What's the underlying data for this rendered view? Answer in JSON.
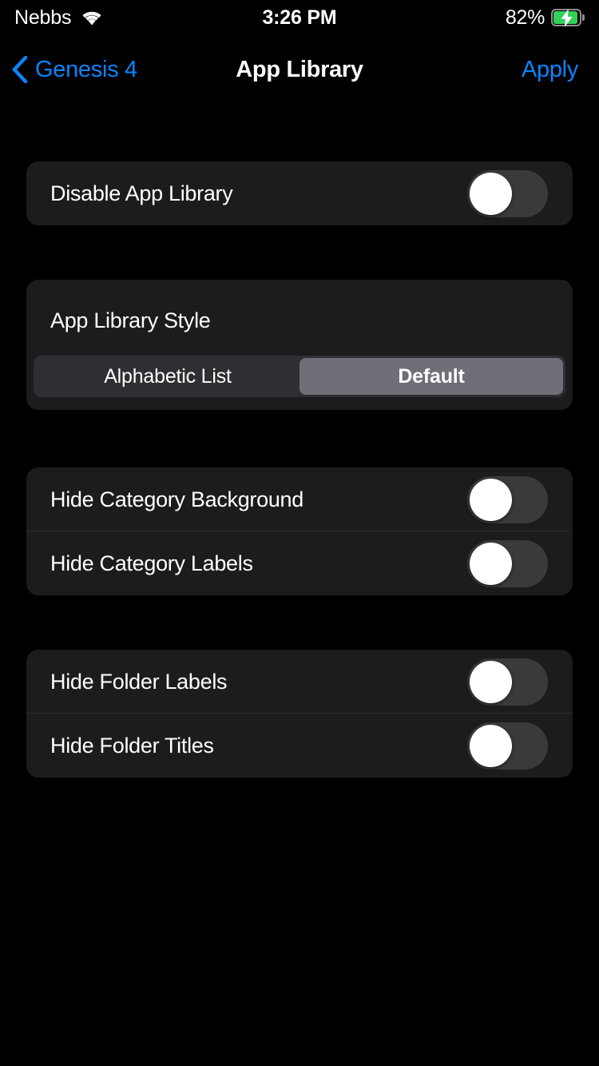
{
  "status_bar": {
    "carrier": "Nebbs",
    "wifi_icon": "wifi-icon",
    "time": "3:26 PM",
    "battery_percent": "82%",
    "battery_icon": "battery-charging-icon",
    "battery_color": "#30d158"
  },
  "nav_bar": {
    "back_icon": "chevron-left-icon",
    "back_label": "Genesis 4",
    "title": "App Library",
    "apply_label": "Apply",
    "accent_color": "#0a84ff"
  },
  "sections": {
    "disable": {
      "rows": [
        {
          "label": "Disable App Library",
          "toggle": "off"
        }
      ]
    },
    "style": {
      "title": "App Library Style",
      "segments": [
        {
          "label": "Alphabetic List",
          "selected": false
        },
        {
          "label": "Default",
          "selected": true
        }
      ],
      "selected_value": "Default"
    },
    "category": {
      "rows": [
        {
          "label": "Hide Category Background",
          "toggle": "off"
        },
        {
          "label": "Hide Category Labels",
          "toggle": "off"
        }
      ]
    },
    "folder": {
      "rows": [
        {
          "label": "Hide Folder Labels",
          "toggle": "off"
        },
        {
          "label": "Hide Folder Titles",
          "toggle": "off"
        }
      ]
    }
  },
  "theme": {
    "background": "#000000",
    "card_background": "#1c1c1e",
    "toggle_track_off": "#3a3a3c",
    "segment_track": "#2f2f33",
    "segment_selected": "#6f6f78"
  }
}
